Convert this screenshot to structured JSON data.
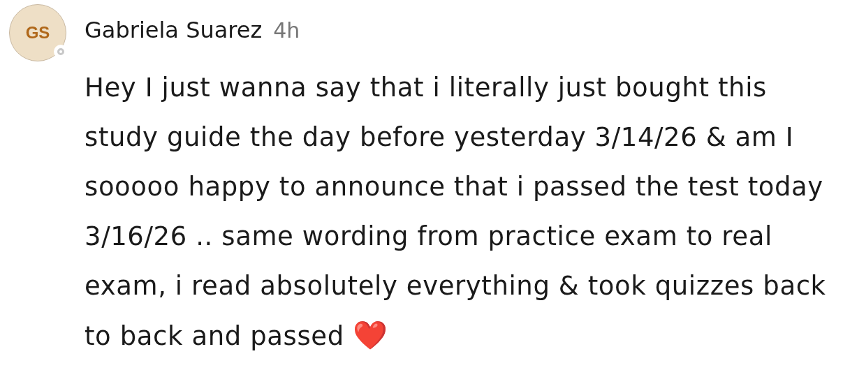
{
  "comment": {
    "author": {
      "initials": "GS",
      "name": "Gabriela Suarez",
      "online": false
    },
    "time": "4h",
    "text": "Hey I just wanna say that i literally just bought this study guide the day before yesterday 3/14/26 & am I sooooo happy to announce that i passed the test today 3/16/26 .. same wording from practice exam to real exam, i read absolutely everything & took quizzes back to back and passed ❤️"
  }
}
